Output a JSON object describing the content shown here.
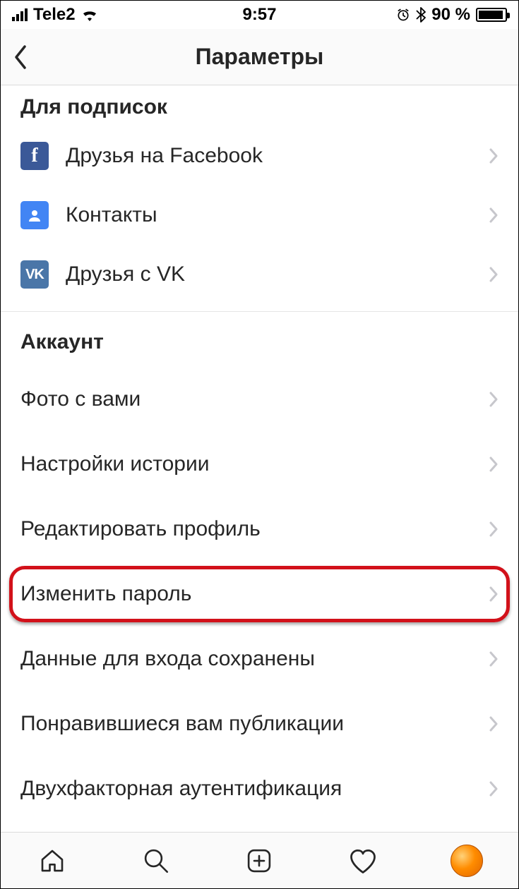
{
  "statusbar": {
    "carrier": "Tele2",
    "time": "9:57",
    "battery_percent": "90 %"
  },
  "header": {
    "title": "Параметры"
  },
  "sections": {
    "follow": {
      "title": "Для подписок",
      "items": [
        {
          "label": "Друзья на Facebook"
        },
        {
          "label": "Контакты"
        },
        {
          "label": "Друзья с VK"
        }
      ]
    },
    "account": {
      "title": "Аккаунт",
      "items": [
        {
          "label": "Фото с вами"
        },
        {
          "label": "Настройки истории"
        },
        {
          "label": "Редактировать профиль"
        },
        {
          "label": "Изменить пароль"
        },
        {
          "label": "Данные для входа сохранены"
        },
        {
          "label": "Понравившиеся вам публикации"
        },
        {
          "label": "Двухфакторная аутентификация"
        }
      ]
    }
  }
}
